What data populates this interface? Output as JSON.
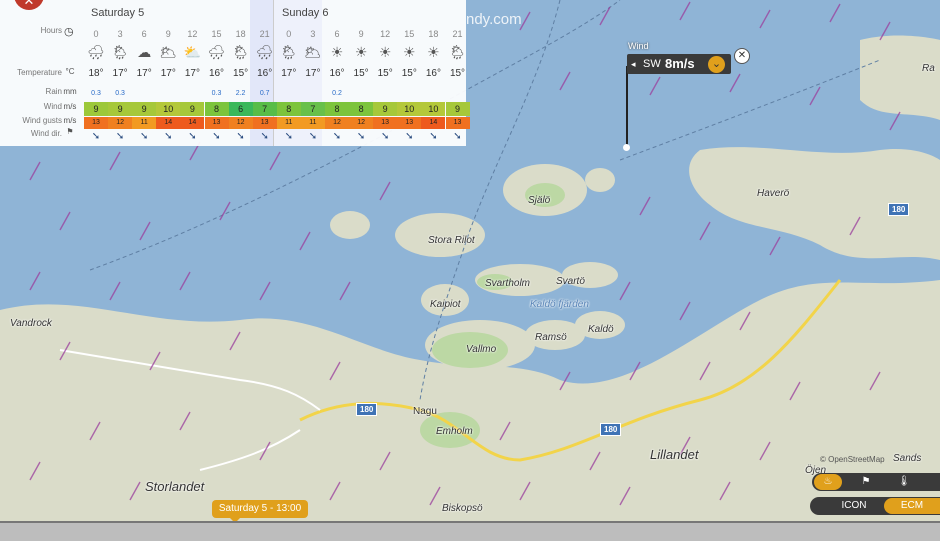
{
  "brand": "ndy.com",
  "forecast": {
    "row_labels": {
      "hours": "Hours",
      "temperature": "Temperature",
      "rain": "Rain",
      "wind": "Wind",
      "gusts": "Wind gusts",
      "dir": "Wind dir."
    },
    "units": {
      "temperature": "°C",
      "rain": "mm",
      "wind": "m/s",
      "gusts": "m/s"
    },
    "days": [
      "Saturday 5",
      "Sunday 6"
    ],
    "hours": [
      "0",
      "3",
      "6",
      "9",
      "12",
      "15",
      "18",
      "21",
      "0",
      "3",
      "6",
      "9",
      "12",
      "15",
      "18",
      "21"
    ],
    "icons": [
      "🌧",
      "🌦",
      "☁",
      "🌥",
      "⛅",
      "🌧",
      "🌦",
      "🌧",
      "🌦",
      "🌥",
      "☀",
      "☀",
      "☀",
      "☀",
      "☀",
      "🌦"
    ],
    "temps": [
      "18°",
      "17°",
      "17°",
      "17°",
      "17°",
      "16°",
      "15°",
      "16°",
      "17°",
      "17°",
      "16°",
      "15°",
      "15°",
      "15°",
      "16°",
      "15°"
    ],
    "rain": [
      "0.3",
      "0.3",
      "",
      "",
      "",
      "0.3",
      "2.2",
      "0.7",
      "",
      "",
      "0.2",
      "",
      "",
      "",
      "",
      ""
    ],
    "wind": [
      "9",
      "9",
      "9",
      "10",
      "9",
      "8",
      "6",
      "7",
      "8",
      "7",
      "8",
      "8",
      "9",
      "10",
      "10",
      "9"
    ],
    "wind_colors": [
      "#9cc83a",
      "#a6c83a",
      "#a6c83a",
      "#b4c83a",
      "#a6c83a",
      "#7cc43c",
      "#3ab85a",
      "#58bd48",
      "#7cc43c",
      "#68c04a",
      "#7cc43c",
      "#7cc43c",
      "#a6c83a",
      "#b4c83a",
      "#b4c83a",
      "#a6c83a"
    ],
    "gusts": [
      "13",
      "12",
      "11",
      "14",
      "14",
      "13",
      "12",
      "13",
      "11",
      "11",
      "12",
      "12",
      "13",
      "13",
      "14",
      "13"
    ],
    "gust_colors": [
      "#f07020",
      "#f08020",
      "#f29a22",
      "#ee5a1e",
      "#ee5a1e",
      "#f07020",
      "#f08020",
      "#f07020",
      "#f29a22",
      "#f29a22",
      "#f08020",
      "#f08020",
      "#f07020",
      "#f07020",
      "#ee5a1e",
      "#f07020"
    ],
    "dir_glyph": "➘"
  },
  "picker": {
    "title": "Wind",
    "direction": "SW",
    "speed": "8m/s"
  },
  "places": [
    {
      "name": "Själö"
    },
    {
      "name": "Stora Rilot"
    },
    {
      "name": "Svartholm"
    },
    {
      "name": "Svartö"
    },
    {
      "name": "Kaldö fjärden"
    },
    {
      "name": "Kaipiot"
    },
    {
      "name": "Kaldö"
    },
    {
      "name": "Ramsö"
    },
    {
      "name": "Vallmo"
    },
    {
      "name": "Haverö"
    },
    {
      "name": "Vandrock"
    },
    {
      "name": "Nagu"
    },
    {
      "name": "Emholm"
    },
    {
      "name": "Lillandet"
    },
    {
      "name": "Storlandet"
    },
    {
      "name": "Biskopsö"
    },
    {
      "name": "Öjen"
    },
    {
      "name": "Sands"
    },
    {
      "name": "Ra"
    }
  ],
  "road_shields": [
    "180",
    "180",
    "180"
  ],
  "timeline": {
    "current": "Saturday 5 - 13:00"
  },
  "models": [
    "ICON",
    "ECM"
  ],
  "attribution": "© OpenStreetMap"
}
